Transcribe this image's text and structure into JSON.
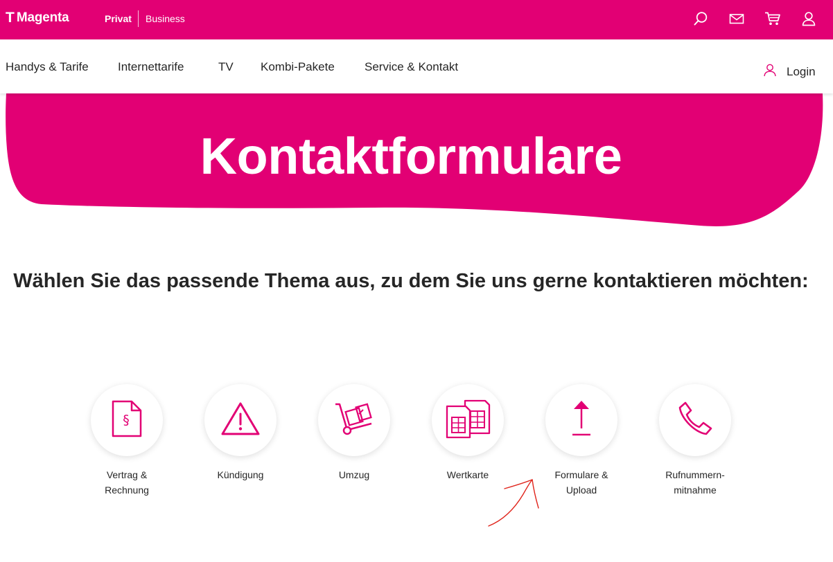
{
  "header": {
    "logo_letter": "T",
    "logo_text": "Magenta",
    "segment_privat": "Privat",
    "segment_business": "Business",
    "icons": [
      "search-icon",
      "mail-icon",
      "cart-icon",
      "user-icon"
    ]
  },
  "nav": {
    "items": [
      "Handys & Tarife",
      "Internettarife",
      "TV",
      "Kombi-Pakete",
      "Service & Kontakt"
    ],
    "login_label": "Login"
  },
  "hero": {
    "title": "Kontaktformulare"
  },
  "intro": {
    "heading": "Wählen Sie das passende Thema aus, zu dem Sie uns gerne kontaktieren möchten:"
  },
  "topics": [
    {
      "label": "Vertrag &\nRechnung",
      "icon": "contract-paragraph-icon"
    },
    {
      "label": "Kündigung",
      "icon": "warning-triangle-icon"
    },
    {
      "label": "Umzug",
      "icon": "hand-truck-icon"
    },
    {
      "label": "Wertkarte",
      "icon": "sim-card-icon"
    },
    {
      "label": "Formulare &\nUpload",
      "icon": "upload-arrow-icon"
    },
    {
      "label": "Rufnummern-\nmitnahme",
      "icon": "phone-icon"
    }
  ],
  "colors": {
    "brand": "#e20074",
    "text": "#262626",
    "annotation": "#e0241b"
  }
}
